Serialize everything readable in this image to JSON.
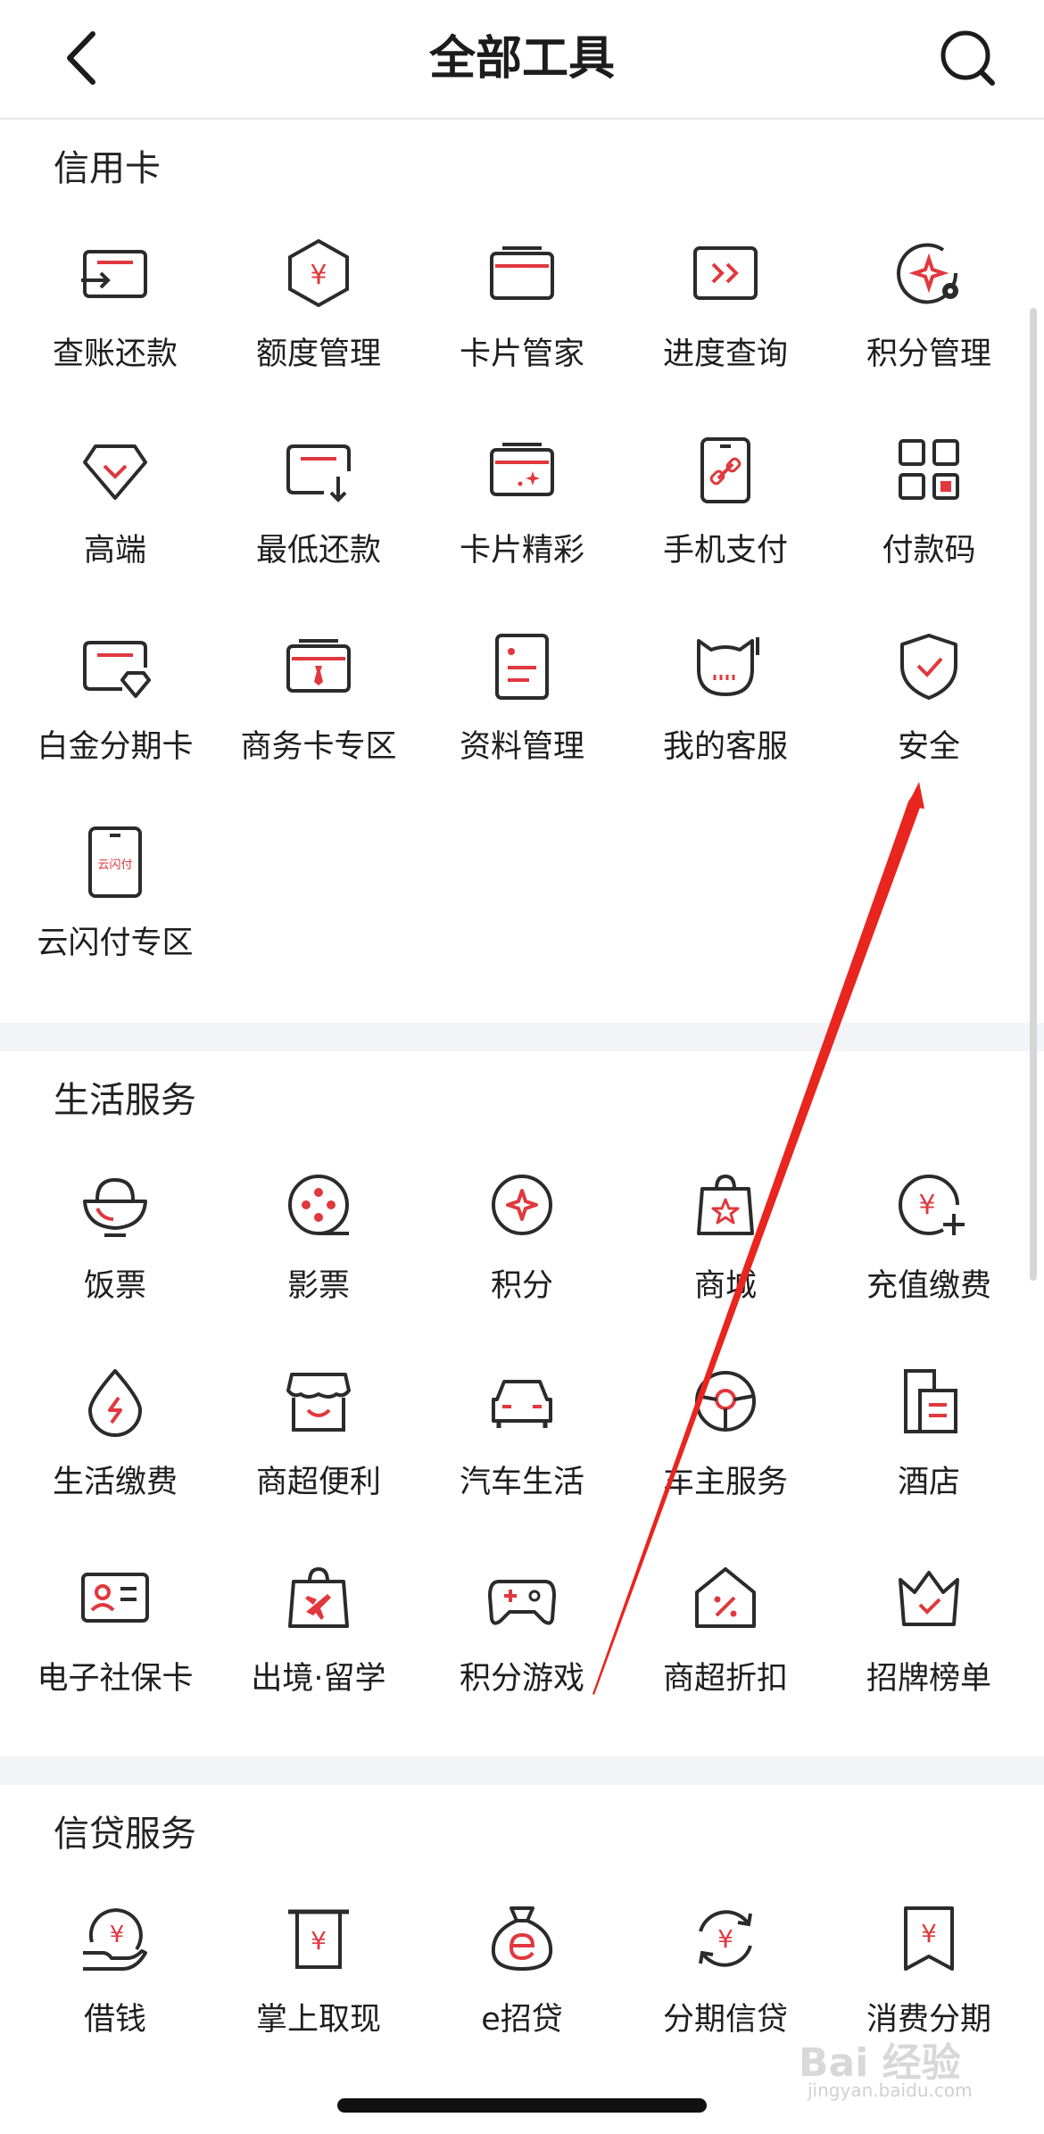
{
  "header": {
    "title": "全部工具"
  },
  "sections": [
    {
      "title": "信用卡",
      "items": [
        {
          "label": "查账还款",
          "icon": "bill-repay-icon"
        },
        {
          "label": "额度管理",
          "icon": "credit-limit-icon"
        },
        {
          "label": "卡片管家",
          "icon": "card-icon"
        },
        {
          "label": "进度查询",
          "icon": "progress-icon"
        },
        {
          "label": "积分管理",
          "icon": "points-settings-icon"
        },
        {
          "label": "高端",
          "icon": "diamond-icon"
        },
        {
          "label": "最低还款",
          "icon": "min-repay-icon"
        },
        {
          "label": "卡片精彩",
          "icon": "card-sparkle-icon"
        },
        {
          "label": "手机支付",
          "icon": "phone-pay-icon"
        },
        {
          "label": "付款码",
          "icon": "qr-code-icon"
        },
        {
          "label": "白金分期卡",
          "icon": "platinum-card-icon"
        },
        {
          "label": "商务卡专区",
          "icon": "business-card-icon"
        },
        {
          "label": "资料管理",
          "icon": "document-icon"
        },
        {
          "label": "我的客服",
          "icon": "customer-service-icon"
        },
        {
          "label": "安全",
          "icon": "shield-check-icon"
        },
        {
          "label": "云闪付专区",
          "icon": "unionpay-quickpass-icon",
          "badge": "云闪付"
        }
      ]
    },
    {
      "title": "生活服务",
      "items": [
        {
          "label": "饭票",
          "icon": "rice-bowl-icon"
        },
        {
          "label": "影票",
          "icon": "film-reel-icon"
        },
        {
          "label": "积分",
          "icon": "points-icon"
        },
        {
          "label": "商城",
          "icon": "shopping-bag-icon"
        },
        {
          "label": "充值缴费",
          "icon": "recharge-icon"
        },
        {
          "label": "生活缴费",
          "icon": "utility-drop-icon"
        },
        {
          "label": "商超便利",
          "icon": "store-icon"
        },
        {
          "label": "汽车生活",
          "icon": "car-icon"
        },
        {
          "label": "车主服务",
          "icon": "steering-wheel-icon"
        },
        {
          "label": "酒店",
          "icon": "hotel-icon"
        },
        {
          "label": "电子社保卡",
          "icon": "social-security-card-icon"
        },
        {
          "label": "出境·留学",
          "icon": "travel-bag-icon"
        },
        {
          "label": "积分游戏",
          "icon": "gamepad-icon"
        },
        {
          "label": "商超折扣",
          "icon": "discount-icon"
        },
        {
          "label": "招牌榜单",
          "icon": "crown-ranking-icon"
        }
      ]
    },
    {
      "title": "信贷服务",
      "items": [
        {
          "label": "借钱",
          "icon": "borrow-money-icon"
        },
        {
          "label": "掌上取现",
          "icon": "cash-withdraw-icon"
        },
        {
          "label": "e招贷",
          "icon": "money-bag-icon"
        },
        {
          "label": "分期信贷",
          "icon": "installment-loan-icon"
        },
        {
          "label": "消费分期",
          "icon": "consumer-installment-icon"
        }
      ]
    }
  ],
  "colors": {
    "accent": "#e0383e",
    "stroke": "#2b2b2b",
    "separator": "#f3f4f8"
  },
  "watermark": {
    "text": "Bai 经验",
    "sub": "jingyan.baidu.com"
  }
}
